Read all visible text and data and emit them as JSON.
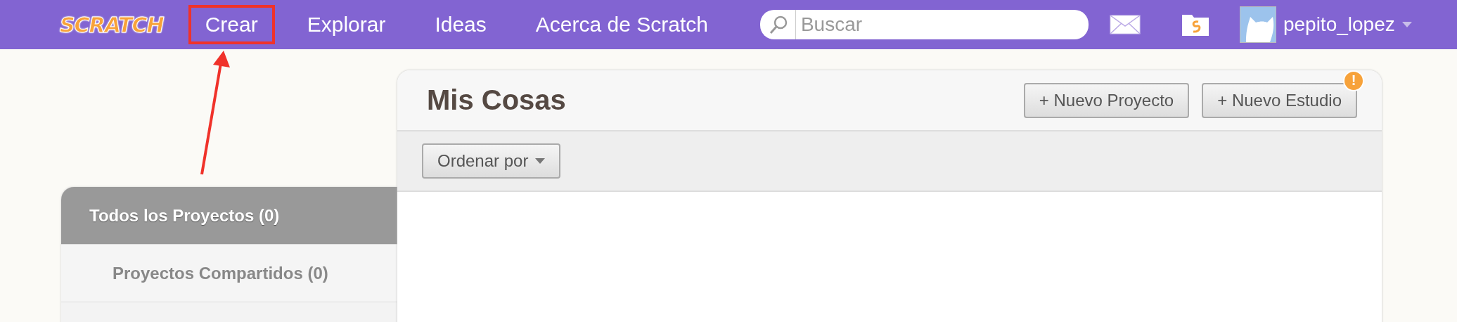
{
  "navbar": {
    "logo": "SCRATCH",
    "items": [
      {
        "label": "Crear",
        "highlighted": true
      },
      {
        "label": "Explorar",
        "highlighted": false
      },
      {
        "label": "Ideas",
        "highlighted": false
      },
      {
        "label": "Acerca de Scratch",
        "highlighted": false
      }
    ],
    "search": {
      "placeholder": "Buscar"
    },
    "user": {
      "name": "pepito_lopez"
    }
  },
  "sidebar": {
    "items": [
      {
        "label": "Todos los Proyectos (0)",
        "selected": true
      },
      {
        "label": "Proyectos Compartidos (0)",
        "selected": false
      }
    ]
  },
  "main": {
    "title": "Mis Cosas",
    "buttons": [
      {
        "label": "+ Nuevo Proyecto"
      },
      {
        "label": "+ Nuevo Estudio",
        "badge": "!"
      }
    ],
    "sort_button": "Ordenar por"
  }
}
